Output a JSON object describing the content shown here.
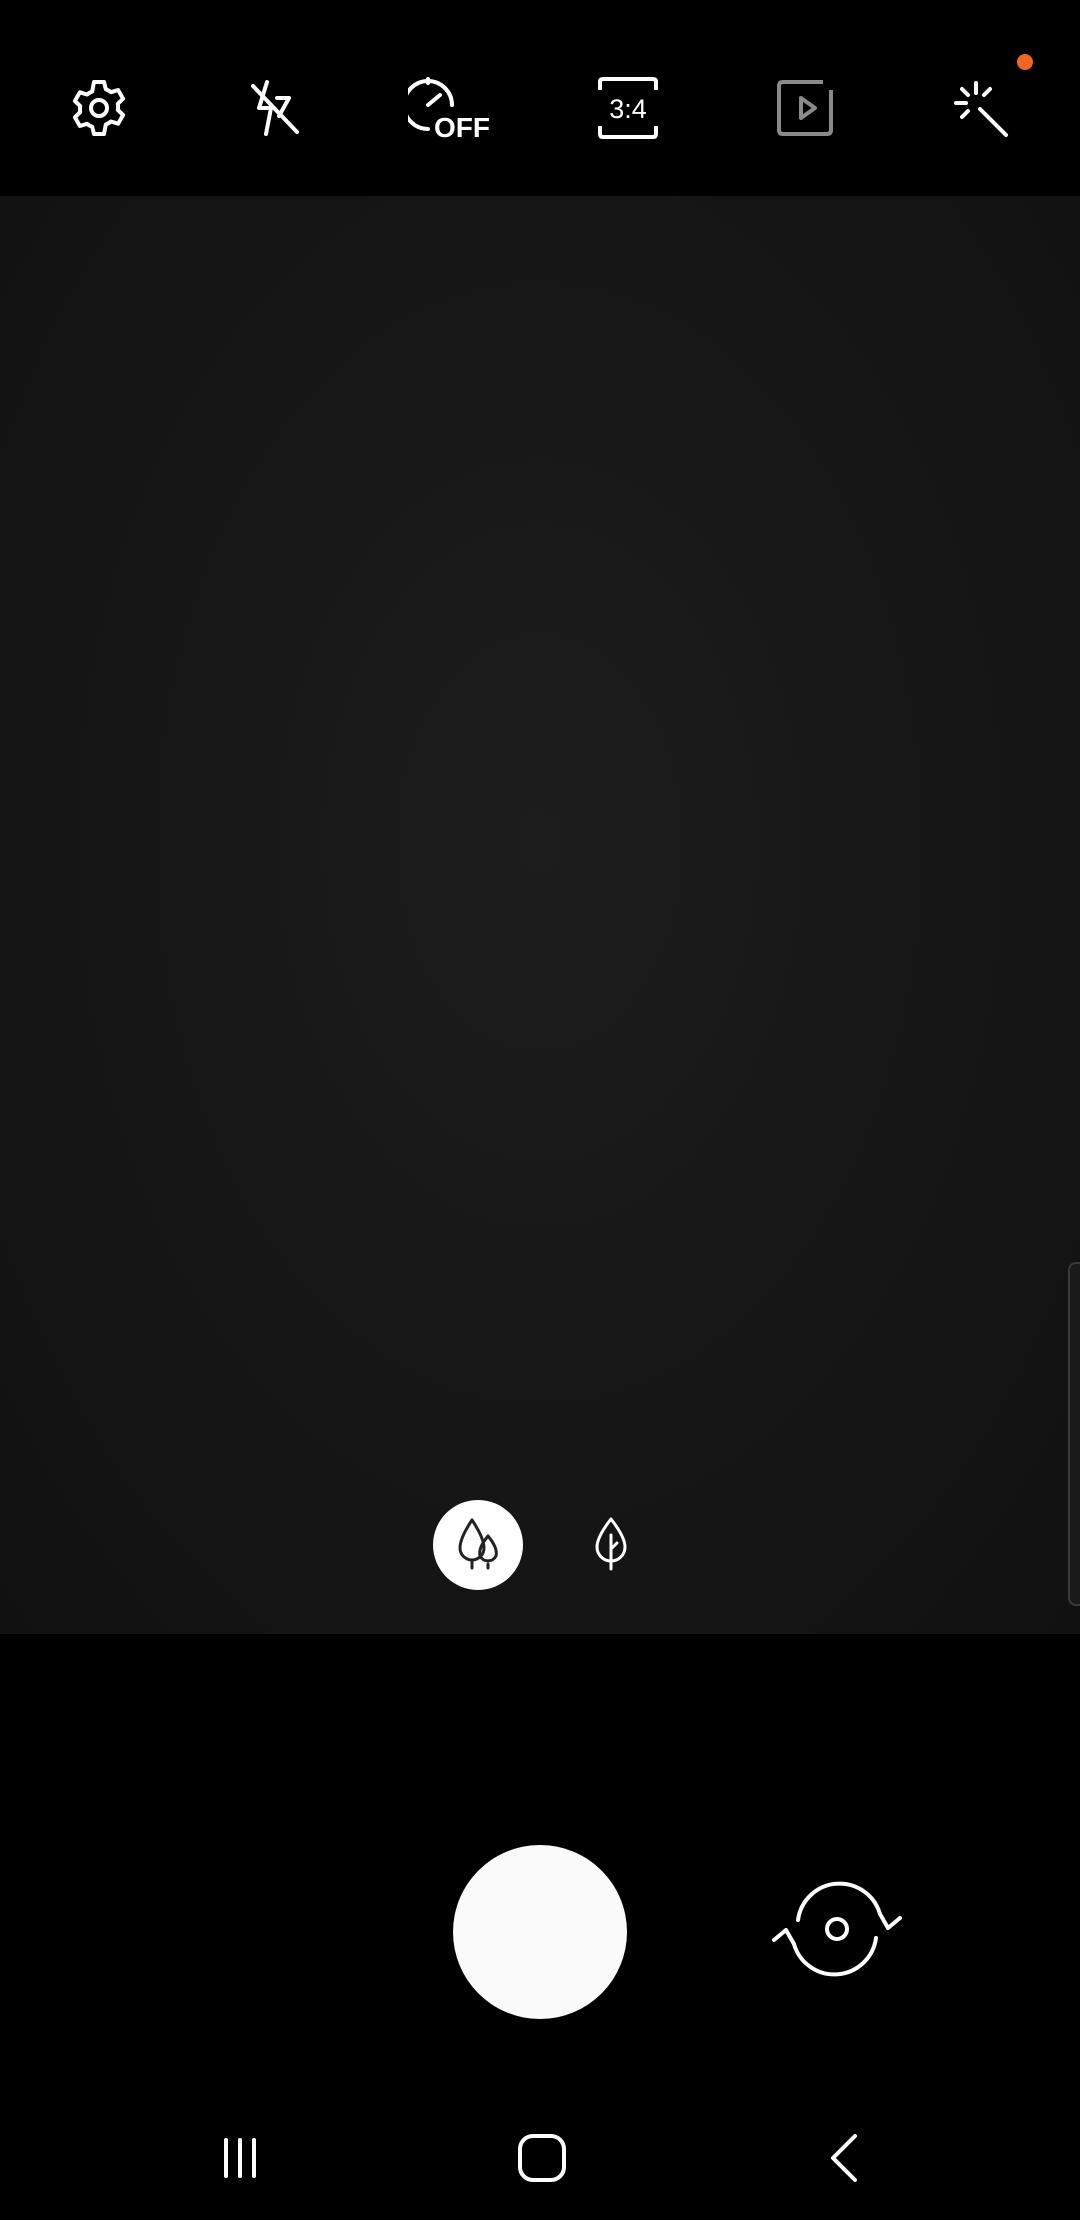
{
  "top_bar": {
    "settings_icon": "gear-icon",
    "flash_icon": "flash-off-icon",
    "timer_icon": "timer-icon",
    "timer_label": "OFF",
    "ratio_icon": "aspect-ratio-icon",
    "ratio_label": "3:4",
    "motion_photo_icon": "motion-photo-icon",
    "filters_icon": "magic-wand-icon"
  },
  "lens": {
    "wide_icon": "two-trees-icon",
    "normal_icon": "single-tree-icon"
  },
  "controls": {
    "switch_camera_icon": "switch-camera-icon"
  },
  "nav": {
    "recent_icon": "recent-apps-icon",
    "home_icon": "home-icon",
    "back_icon": "back-icon"
  },
  "colors": {
    "accent_dot": "#f26522",
    "viewfinder": "#171717",
    "motion_photo_icon": "#8a8a8a"
  }
}
